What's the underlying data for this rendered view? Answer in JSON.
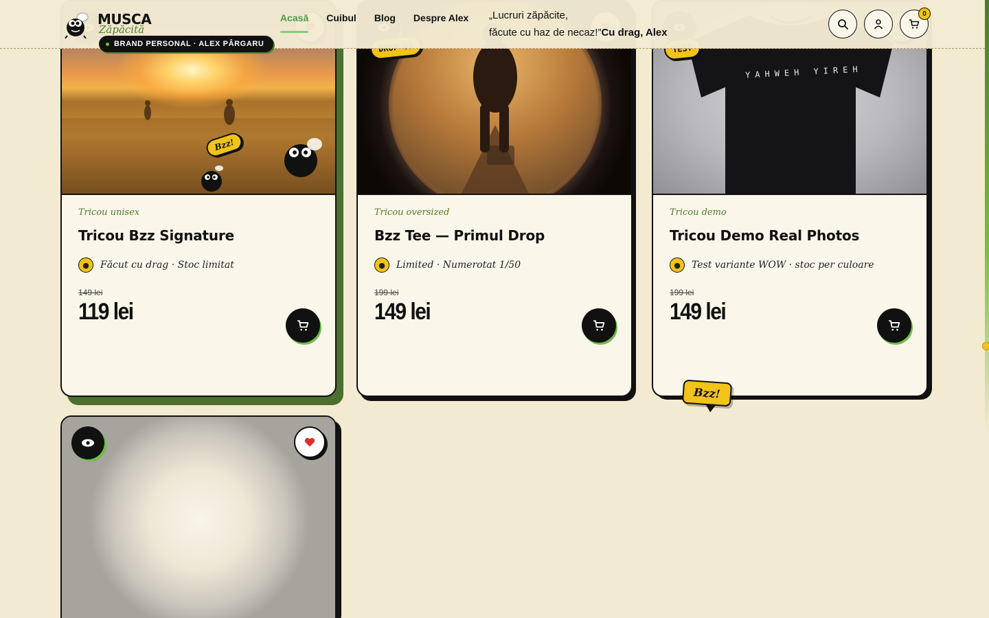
{
  "header": {
    "logo": {
      "line1": "MUSCA",
      "line2": "Zăpăcită",
      "pill": "BRAND PERSONAL · ALEX PÂRGARU"
    },
    "nav": [
      {
        "label": "Acasă",
        "active": true
      },
      {
        "label": "Cuibul",
        "active": false
      },
      {
        "label": "Blog",
        "active": false
      },
      {
        "label": "Despre Alex",
        "active": false
      }
    ],
    "quote": {
      "line1": "„Lucruri zăpăcite,",
      "line2": "făcute cu haz de necaz!”",
      "signature": "Cu drag, Alex"
    },
    "cart_count": "0",
    "icons": {
      "search": "search-icon",
      "account": "user-icon",
      "cart": "cart-icon"
    }
  },
  "products": [
    {
      "category": "Tricou unisex",
      "title": "Tricou Bzz Signature",
      "meta": "Făcut cu drag · Stoc limitat",
      "old_price": "149 lei",
      "price": "119 lei",
      "badge": "",
      "sticker": "Bzz!"
    },
    {
      "category": "Tricou oversized",
      "title": "Bzz Tee — Primul Drop",
      "meta": "Limited · Numerotat 1/50",
      "old_price": "199 lei",
      "price": "149 lei",
      "badge": "DROP 01"
    },
    {
      "category": "Tricou demo",
      "title": "Tricou Demo Real Photos",
      "meta": "Test variante WOW · stoc per culoare",
      "old_price": "199 lei",
      "price": "149 lei",
      "badge": "TEST",
      "shirt_text": "YAHWEH YIREH"
    }
  ],
  "floating_bubble": "Bzz!",
  "colors": {
    "background": "#f3ead2",
    "accent_green": "#4c7a2c",
    "accent_yellow": "#f2c318",
    "ink": "#111111"
  }
}
